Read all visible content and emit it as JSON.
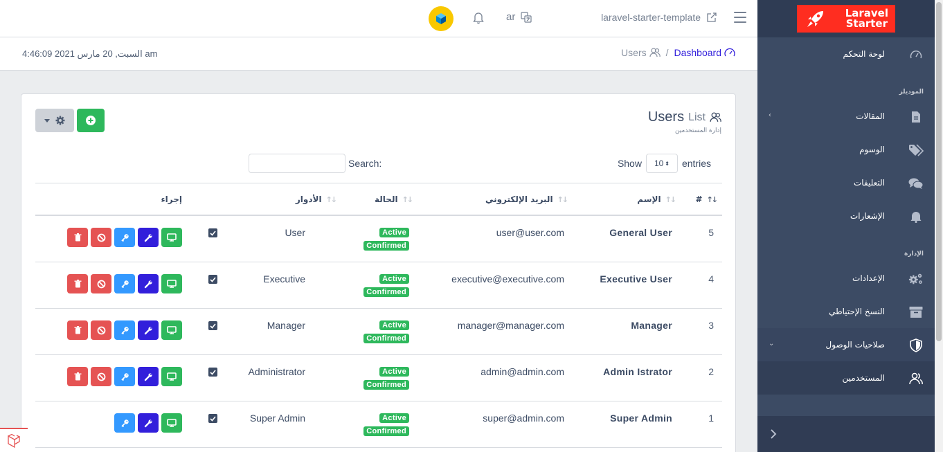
{
  "header": {
    "project_link": "laravel-starter-template",
    "language": "ar"
  },
  "subheader": {
    "datetime": "السبت, 20 مارس 2021 4:46:09 am",
    "breadcrumb": {
      "current": "Users",
      "home": "Dashboard"
    }
  },
  "card": {
    "title_main": "Users",
    "title_sub": "List",
    "subtitle": "إدارة المستخدمين"
  },
  "table_controls": {
    "show_label": "Show",
    "entries_value": "10",
    "entries_label": "entries",
    "search_label": "Search:"
  },
  "table": {
    "headers": {
      "id": "#",
      "name": "الإسم",
      "email": "البريد الإلكتروني",
      "status": "الحالة",
      "roles": "الأدوار",
      "action": "إجراء"
    },
    "rows": [
      {
        "id": "5",
        "name": "General User",
        "email": "user@user.com",
        "status": "Active",
        "confirmed": "Confirmed",
        "role": "User"
      },
      {
        "id": "4",
        "name": "Executive User",
        "email": "executive@executive.com",
        "status": "Active",
        "confirmed": "Confirmed",
        "role": "Executive"
      },
      {
        "id": "3",
        "name": "Manager",
        "email": "manager@manager.com",
        "status": "Active",
        "confirmed": "Confirmed",
        "role": "Manager"
      },
      {
        "id": "2",
        "name": "Admin Istrator",
        "email": "admin@admin.com",
        "status": "Active",
        "confirmed": "Confirmed",
        "role": "Administrator"
      },
      {
        "id": "1",
        "name": "Super Admin",
        "email": "super@admin.com",
        "status": "Active",
        "confirmed": "Confirmed",
        "role": "Super Admin"
      }
    ]
  },
  "sidebar": {
    "brand_line1": "Laravel",
    "brand_line2": "Starter",
    "dashboard": "لوحة التحكم",
    "section_modules": "الموديلز",
    "posts": "المقالات",
    "tags": "الوسوم",
    "comments": "التعليقات",
    "notifications": "الإشعارات",
    "section_admin": "الإدارة",
    "settings": "الإعدادات",
    "backups": "النسخ الإحتياطي",
    "access_control": "صلاحيات الوصول",
    "users": "المستخدمين"
  },
  "colors": {
    "primary": "#321fdb",
    "success": "#2eb85c",
    "info": "#3399ff",
    "danger": "#e55353",
    "sidebar": "#3c4b64",
    "brand": "#ff2d20"
  }
}
